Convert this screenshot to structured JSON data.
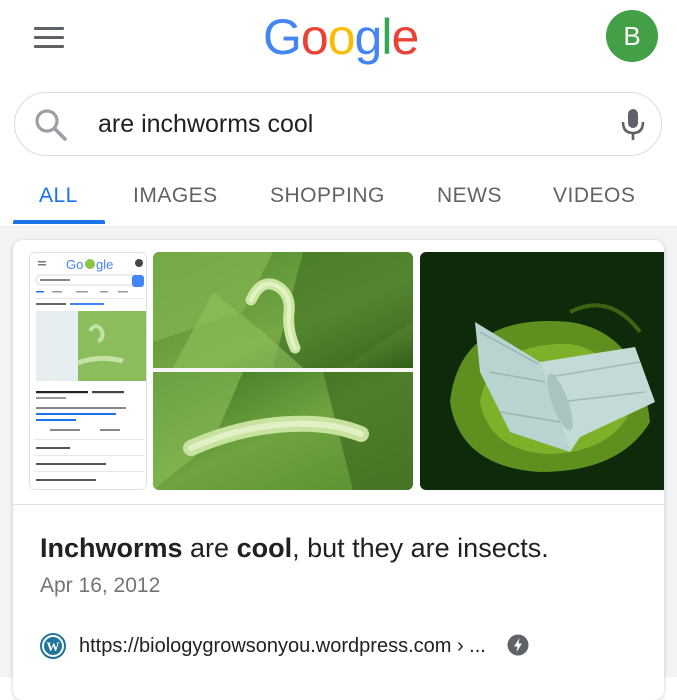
{
  "header": {
    "logo_text": "Google",
    "logo_letters": [
      {
        "ch": "G",
        "color": "#4285F4"
      },
      {
        "ch": "o",
        "color": "#EA4335"
      },
      {
        "ch": "o",
        "color": "#FBBC05"
      },
      {
        "ch": "g",
        "color": "#4285F4"
      },
      {
        "ch": "l",
        "color": "#34A853"
      },
      {
        "ch": "e",
        "color": "#EA4335"
      }
    ],
    "avatar_letter": "B",
    "avatar_color": "#43a047",
    "menu_icon": "hamburger-menu-icon"
  },
  "search": {
    "query": "are inchworms cool",
    "search_icon": "search-icon",
    "mic_icon": "microphone-icon"
  },
  "tabs": [
    {
      "label": "ALL",
      "active": true
    },
    {
      "label": "IMAGES",
      "active": false
    },
    {
      "label": "SHOPPING",
      "active": false
    },
    {
      "label": "NEWS",
      "active": false
    },
    {
      "label": "VIDEOS",
      "active": false
    }
  ],
  "accent_color": "#1a73e8",
  "result": {
    "snippet_bold_1": "Inchworms",
    "snippet_mid": " are ",
    "snippet_bold_2": "cool",
    "snippet_rest": ", but they are insects.",
    "date": "Apr 16, 2012",
    "url": "https://biologygrowsonyou.wordpress.com › ...",
    "site_icon": "wordpress-icon",
    "amp_icon": "amp-lightning-icon"
  },
  "images": [
    {
      "name": "search-screenshot-thumbnail",
      "mini_logo": "Google"
    },
    {
      "name": "green-inchworm-photos"
    },
    {
      "name": "pale-green-moth-photo"
    }
  ]
}
